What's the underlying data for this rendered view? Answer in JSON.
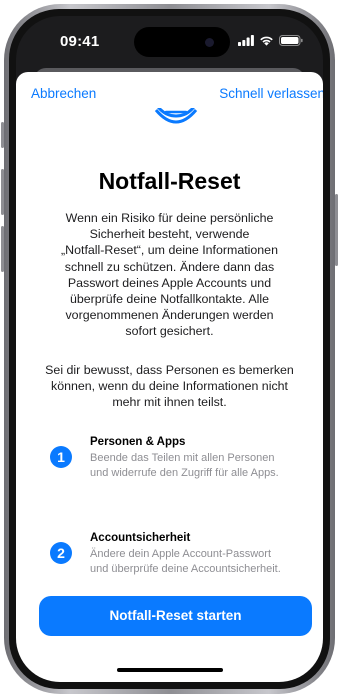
{
  "status_bar": {
    "time": "09:41"
  },
  "nav": {
    "cancel": "Abbrechen",
    "quick_exit": "Schnell verlassen"
  },
  "title": "Notfall-Reset",
  "paragraph1": [
    "Wenn ein Risiko für deine persönliche",
    "Sicherheit besteht, verwende",
    "„Notfall-Reset“, um deine Informationen",
    "schnell zu schützen. Ändere dann das",
    "Passwort deines Apple Accounts und",
    "überprüfe deine Notfallkontakte. Alle",
    "vorgenommenen Änderungen werden",
    "sofort gesichert."
  ],
  "paragraph2": [
    "Sei dir bewusst, dass Personen es bemerken",
    "können, wenn du deine Informationen nicht",
    "mehr mit ihnen teilst."
  ],
  "steps": [
    {
      "number": "1",
      "title": "Personen & Apps",
      "desc": [
        "Beende das Teilen mit allen Personen",
        "und widerrufe den Zugriff für alle Apps."
      ]
    },
    {
      "number": "2",
      "title": "Accountsicherheit",
      "desc": [
        "Ändere dein Apple Account-Passwort",
        "und überprüfe deine Accountsicherheit."
      ]
    }
  ],
  "primary_button": "Notfall-Reset starten",
  "colors": {
    "accent": "#0a7aff",
    "secondary_text": "#8e8e93"
  }
}
